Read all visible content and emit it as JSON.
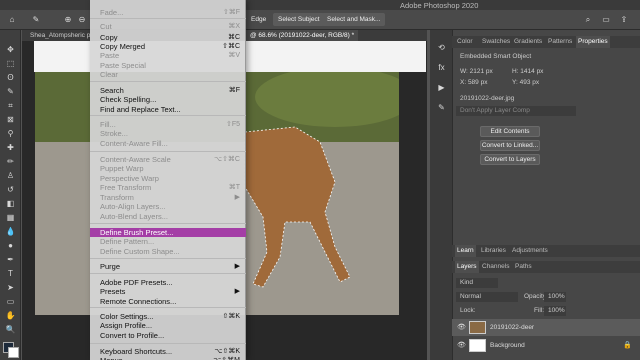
{
  "app": {
    "title": "Adobe Photoshop 2020",
    "options": {
      "edge_label": "Edge",
      "select_subject": "Select Subject",
      "select_and_mask": "Select and Mask..."
    },
    "tabs": [
      {
        "label": "Shea_Atompsheric p"
      },
      {
        "label": "@ 68.6% (20191022-deer, RGB/8) *"
      }
    ]
  },
  "edit_menu": {
    "items": [
      {
        "label": "Fade...",
        "shortcut": "⇧⌘F",
        "disabled": true
      },
      {
        "label": "Cut",
        "shortcut": "⌘X",
        "disabled": true
      },
      {
        "label": "Copy",
        "shortcut": "⌘C",
        "disabled": false
      },
      {
        "label": "Copy Merged",
        "shortcut": "⇧⌘C",
        "disabled": false
      },
      {
        "label": "Paste",
        "shortcut": "⌘V",
        "disabled": true
      },
      {
        "label": "Paste Special",
        "shortcut": "",
        "disabled": true
      },
      {
        "label": "Clear",
        "shortcut": "",
        "disabled": true
      },
      {
        "label": "Search",
        "shortcut": "⌘F",
        "disabled": false
      },
      {
        "label": "Check Spelling...",
        "shortcut": "",
        "disabled": false
      },
      {
        "label": "Find and Replace Text...",
        "shortcut": "",
        "disabled": false
      },
      {
        "label": "Fill...",
        "shortcut": "⇧F5",
        "disabled": true
      },
      {
        "label": "Stroke...",
        "shortcut": "",
        "disabled": true
      },
      {
        "label": "Content-Aware Fill...",
        "shortcut": "",
        "disabled": true
      },
      {
        "label": "Content-Aware Scale",
        "shortcut": "⌥⇧⌘C",
        "disabled": true
      },
      {
        "label": "Puppet Warp",
        "shortcut": "",
        "disabled": true
      },
      {
        "label": "Perspective Warp",
        "shortcut": "",
        "disabled": true
      },
      {
        "label": "Free Transform",
        "shortcut": "⌘T",
        "disabled": true
      },
      {
        "label": "Transform",
        "shortcut": "▶",
        "disabled": true
      },
      {
        "label": "Auto-Align Layers...",
        "shortcut": "",
        "disabled": true
      },
      {
        "label": "Auto-Blend Layers...",
        "shortcut": "",
        "disabled": true
      },
      {
        "label": "Define Brush Preset...",
        "shortcut": "",
        "disabled": false,
        "selected": true
      },
      {
        "label": "Define Pattern...",
        "shortcut": "",
        "disabled": true
      },
      {
        "label": "Define Custom Shape...",
        "shortcut": "",
        "disabled": true
      },
      {
        "label": "Purge",
        "shortcut": "▶",
        "disabled": false
      },
      {
        "label": "Adobe PDF Presets...",
        "shortcut": "",
        "disabled": false
      },
      {
        "label": "Presets",
        "shortcut": "▶",
        "disabled": false
      },
      {
        "label": "Remote Connections...",
        "shortcut": "",
        "disabled": false
      },
      {
        "label": "Color Settings...",
        "shortcut": "⇧⌘K",
        "disabled": false
      },
      {
        "label": "Assign Profile...",
        "shortcut": "",
        "disabled": false
      },
      {
        "label": "Convert to Profile...",
        "shortcut": "",
        "disabled": false
      },
      {
        "label": "Keyboard Shortcuts...",
        "shortcut": "⌥⇧⌘K",
        "disabled": false
      },
      {
        "label": "Menus...",
        "shortcut": "⌥⇧⌘M",
        "disabled": false
      }
    ]
  },
  "properties": {
    "tabs": [
      "Color",
      "Swatches",
      "Gradients",
      "Patterns",
      "Properties"
    ],
    "object_type": "Embedded Smart Object",
    "w": "W: 2121 px",
    "h": "H: 1414 px",
    "x": "X: 589 px",
    "y": "Y: 493 px",
    "filename": "20191022-deer.jpg",
    "layer_comp_placeholder": "Don't Apply Layer Comp",
    "buttons": [
      "Edit Contents",
      "Convert to Linked...",
      "Convert to Layers"
    ]
  },
  "learn_tabs": [
    "Learn",
    "Libraries",
    "Adjustments"
  ],
  "layers": {
    "tabs": [
      "Layers",
      "Channels",
      "Paths"
    ],
    "kind": "Kind",
    "blend_mode": "Normal",
    "opacity_label": "Opacity:",
    "opacity": "100%",
    "lock_label": "Lock:",
    "fill_label": "Fill:",
    "fill": "100%",
    "items": [
      {
        "name": "20191022-deer",
        "selected": true
      },
      {
        "name": "Background",
        "selected": false
      }
    ]
  },
  "colors": {
    "accent": "#a43ea6",
    "panel": "#474747",
    "toolbar": "#3f3f3f"
  }
}
